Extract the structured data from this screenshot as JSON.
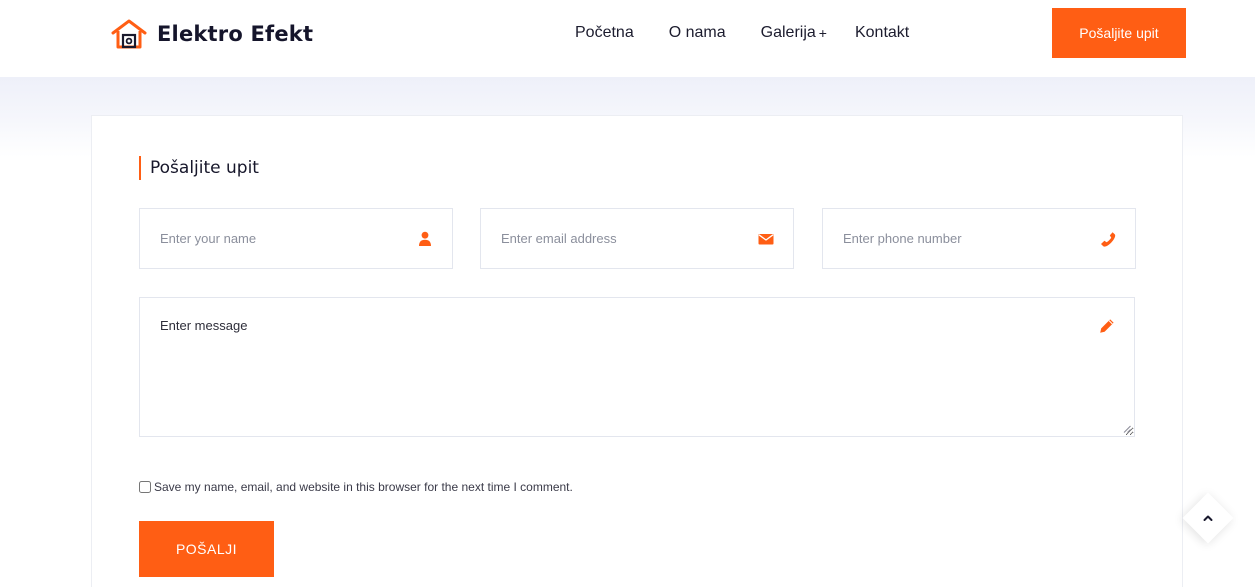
{
  "brand": {
    "name": "Elektro Efekt",
    "accent": "#ff5e14"
  },
  "nav": {
    "items": [
      {
        "label": "Početna"
      },
      {
        "label": "O nama"
      },
      {
        "label": "Galerija",
        "suffix": "+"
      },
      {
        "label": "Kontakt"
      }
    ],
    "cta_label": "Pošaljite upit"
  },
  "form": {
    "title": "Pošaljite upit",
    "name": {
      "placeholder": "Enter your name",
      "icon": "user-icon"
    },
    "email": {
      "placeholder": "Enter email address",
      "icon": "envelope-icon"
    },
    "phone": {
      "placeholder": "Enter phone number",
      "icon": "phone-icon"
    },
    "message": {
      "placeholder": "Enter message",
      "icon": "pencil-icon"
    },
    "consent_label": "Save my name, email, and website in this browser for the next time I comment.",
    "submit_label": "POŠALJI"
  },
  "scroll_top": {
    "icon": "chevron-up-icon"
  }
}
